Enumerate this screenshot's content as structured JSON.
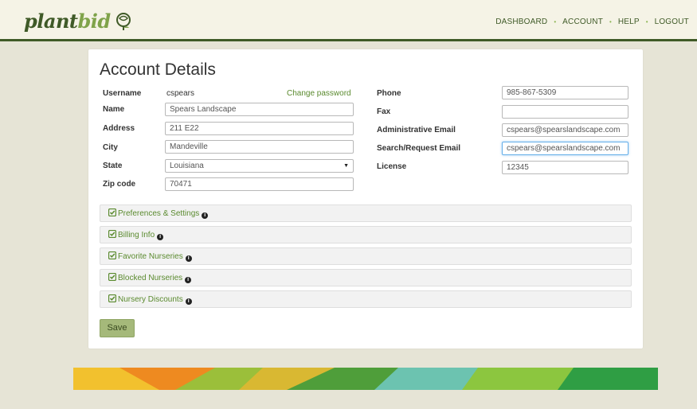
{
  "brand": {
    "name_part1": "plant",
    "name_part2": "bid"
  },
  "nav": {
    "items": [
      "DASHBOARD",
      "ACCOUNT",
      "HELP",
      "LOGOUT"
    ],
    "separator": "•"
  },
  "page": {
    "title": "Account Details"
  },
  "account": {
    "username_label": "Username",
    "username": "cspears",
    "change_password": "Change password",
    "name_label": "Name",
    "name": "Spears Landscape",
    "address_label": "Address",
    "address": "211 E22",
    "city_label": "City",
    "city": "Mandeville",
    "state_label": "State",
    "state": "Louisiana",
    "zip_label": "Zip code",
    "zip": "70471",
    "phone_label": "Phone",
    "phone": "985-867-5309",
    "fax_label": "Fax",
    "fax": "",
    "admin_email_label": "Administrative Email",
    "admin_email": "cspears@spearslandscape.com",
    "search_email_label": "Search/Request Email",
    "search_email": "cspears@spearslandscape.com",
    "license_label": "License",
    "license": "12345"
  },
  "panels": [
    "Preferences & Settings",
    "Billing Info",
    "Favorite Nurseries",
    "Blocked Nurseries",
    "Nursery Discounts"
  ],
  "actions": {
    "save": "Save"
  },
  "colors": {
    "brand_dark": "#3f5a27",
    "brand_light": "#7fa34a",
    "link_green": "#5a8a2e",
    "save_button": "#a5b97a"
  },
  "icons": {
    "logo": "rose-icon",
    "panel": "check-square-icon",
    "info": "info-circle-icon",
    "select": "caret-down-icon"
  }
}
